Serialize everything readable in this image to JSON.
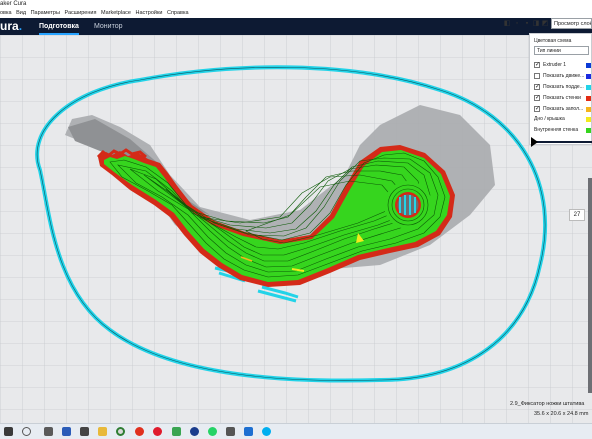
{
  "window": {
    "title": "aker Cura"
  },
  "menu": [
    "овка",
    "Вид",
    "Параметры",
    "Расширения",
    "Marketplace",
    "Настройки",
    "Справка"
  ],
  "header": {
    "logo": "ura",
    "logo_dot": ".",
    "stages": [
      "Подготовка",
      "Монитор"
    ]
  },
  "view_controls": {
    "icons": [
      "3d-view-icon",
      "front-view-icon",
      "top-view-icon",
      "left-view-icon",
      "right-view-icon"
    ],
    "mode_select": "Просмотр слоёв"
  },
  "preview_panel": {
    "color_scheme_label": "Цветовая схема",
    "color_scheme_value": "Тип линии",
    "items": [
      {
        "label": "Extruder 1",
        "checked": true,
        "color": "#0b3bd6"
      },
      {
        "label": "Показать движе...",
        "checked": false,
        "color": "#1b2be0"
      },
      {
        "label": "Показать подде...",
        "checked": true,
        "color": "#23d3e8"
      },
      {
        "label": "Показать стенки",
        "checked": true,
        "color": "#e32b14"
      },
      {
        "label": "Показать запол...",
        "checked": true,
        "color": "#f4b51c"
      },
      {
        "label": "Дно / крышка",
        "checked": null,
        "color": "#f2ea1d"
      },
      {
        "label": "Внутренняя стенка",
        "checked": null,
        "color": "#36d51e"
      }
    ]
  },
  "layer": {
    "current": "27"
  },
  "object": {
    "name": "2.9_Фиксатор ножки штатива",
    "dimensions": "35.6 x 20.6 x 24.8 mm"
  },
  "taskbar": {
    "icons": [
      "windows-start-icon",
      "search-icon",
      "task-view-icon",
      "calculator-icon",
      "word-icon",
      "app-icon",
      "explorer-icon",
      "chrome-icon",
      "yandex-icon",
      "opera-icon",
      "maps-icon",
      "cura-icon",
      "whatsapp-icon",
      "app-icon-2",
      "mail-icon",
      "skype-icon"
    ]
  }
}
